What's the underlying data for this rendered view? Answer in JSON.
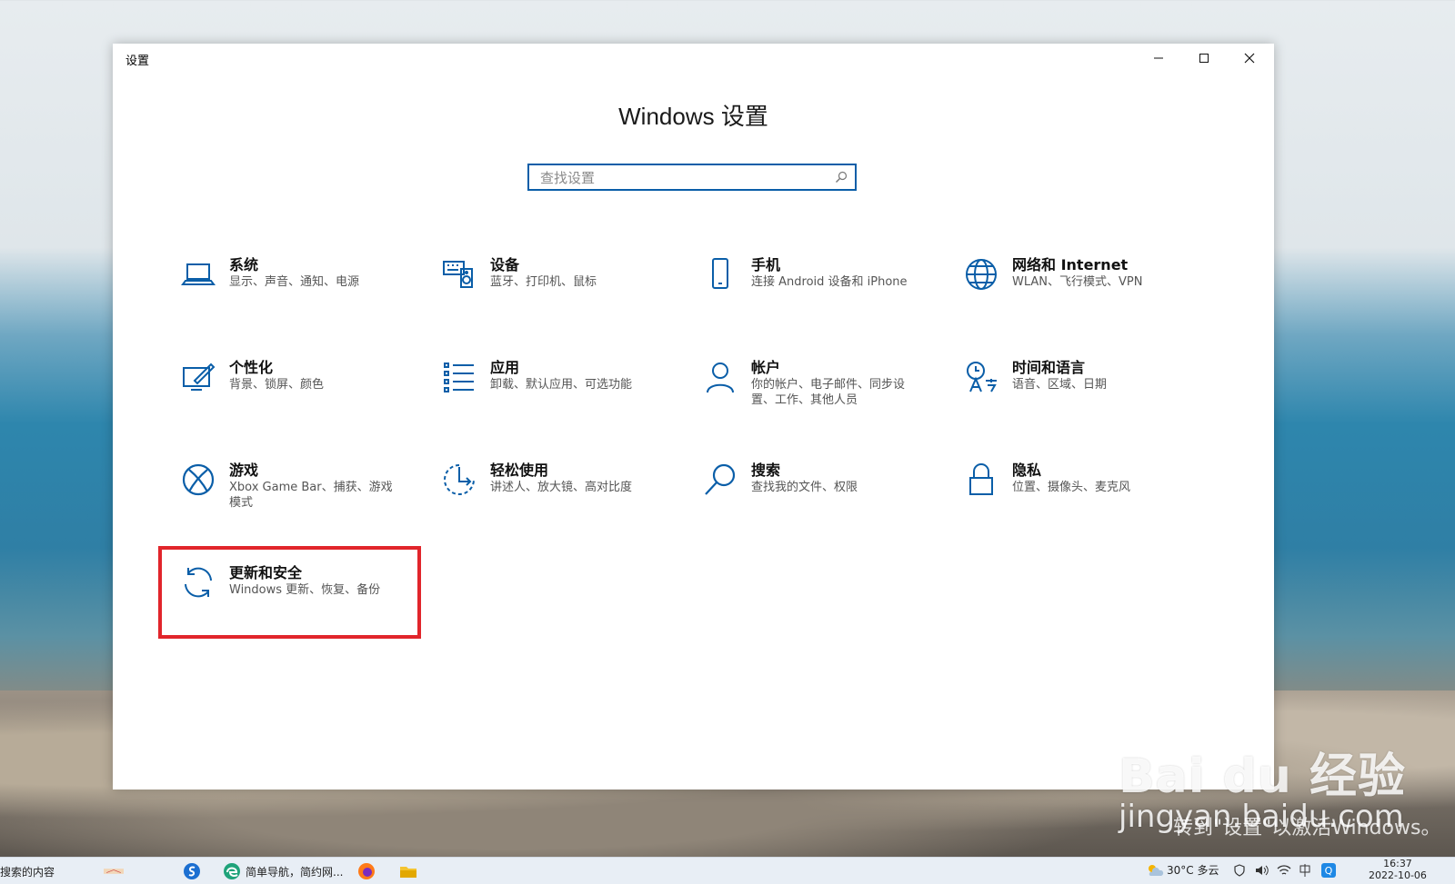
{
  "window": {
    "title": "设置",
    "controls": {
      "minimize": "minimize",
      "maximize": "maximize",
      "close": "close"
    }
  },
  "page": {
    "title": "Windows 设置"
  },
  "search": {
    "placeholder": "查找设置",
    "value": ""
  },
  "tiles": [
    {
      "label": "系统",
      "desc": "显示、声音、通知、电源",
      "icon": "laptop-icon"
    },
    {
      "label": "设备",
      "desc": "蓝牙、打印机、鼠标",
      "icon": "keyboard-speaker-icon"
    },
    {
      "label": "手机",
      "desc": "连接 Android 设备和 iPhone",
      "icon": "phone-icon"
    },
    {
      "label": "网络和 Internet",
      "desc": "WLAN、飞行模式、VPN",
      "icon": "globe-icon"
    },
    {
      "label": "个性化",
      "desc": "背景、锁屏、颜色",
      "icon": "paint-brush-icon"
    },
    {
      "label": "应用",
      "desc": "卸载、默认应用、可选功能",
      "icon": "app-list-icon"
    },
    {
      "label": "帐户",
      "desc": "你的帐户、电子邮件、同步设置、工作、其他人员",
      "icon": "person-icon"
    },
    {
      "label": "时间和语言",
      "desc": "语音、区域、日期",
      "icon": "language-icon"
    },
    {
      "label": "游戏",
      "desc": "Xbox Game Bar、捕获、游戏模式",
      "icon": "xbox-icon"
    },
    {
      "label": "轻松使用",
      "desc": "讲述人、放大镜、高对比度",
      "icon": "ease-of-access-icon"
    },
    {
      "label": "搜索",
      "desc": "查找我的文件、权限",
      "icon": "magnifier-icon"
    },
    {
      "label": "隐私",
      "desc": "位置、摄像头、麦克风",
      "icon": "lock-icon"
    },
    {
      "label": "更新和安全",
      "desc": "Windows 更新、恢复、备份",
      "icon": "sync-icon"
    }
  ],
  "highlight_color": "#e1252b",
  "accent_color": "#0a5ea8",
  "taskbar": {
    "search_text": "搜索的内容",
    "browser_tab": "简单导航，简约网...",
    "weather": "30°C 多云",
    "time": "16:37",
    "date": "2022-10-06"
  },
  "watermark": {
    "logo": "Bai du 经验",
    "domain": "jingyan.baidu.com",
    "caption": "转到\"设置\"以激活Windows。"
  }
}
